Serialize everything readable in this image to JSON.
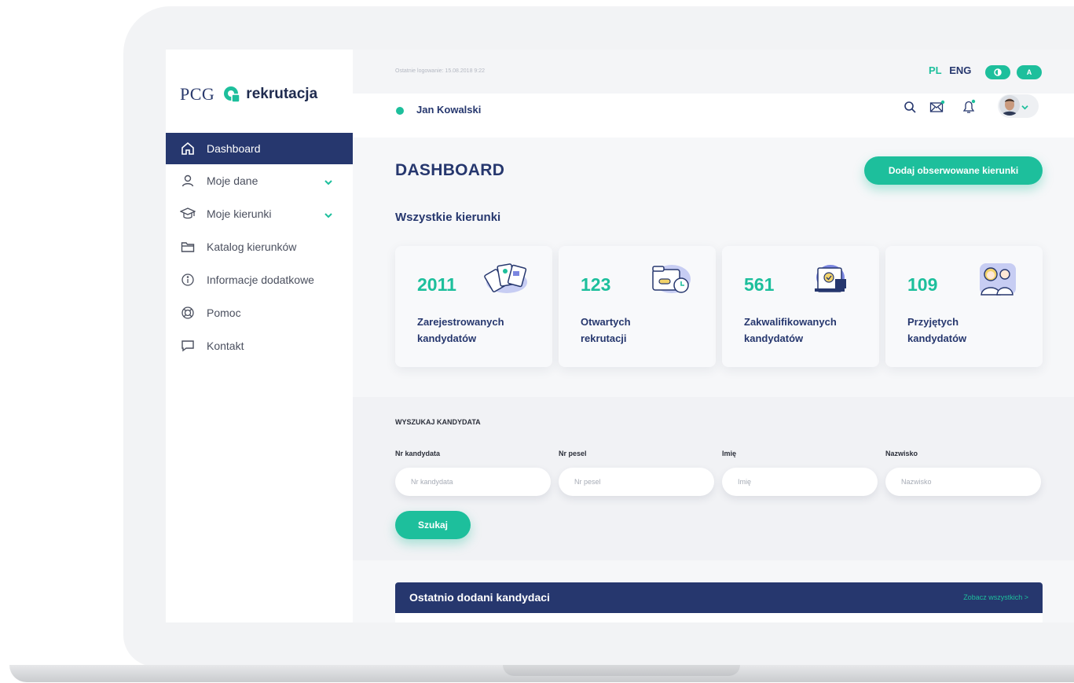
{
  "brand": {
    "pcg": "PCG",
    "word": "rekrutacja"
  },
  "sidebar": {
    "items": [
      {
        "label": "Dashboard",
        "icon": "home-icon",
        "active": true
      },
      {
        "label": "Moje dane",
        "icon": "user-icon",
        "expandable": true
      },
      {
        "label": "Moje kierunki",
        "icon": "graduation-cap-icon",
        "expandable": true
      },
      {
        "label": "Katalog kierunków",
        "icon": "folder-icon"
      },
      {
        "label": "Informacje dodatkowe",
        "icon": "info-icon"
      },
      {
        "label": "Pomoc",
        "icon": "lifebuoy-icon"
      },
      {
        "label": "Kontakt",
        "icon": "chat-icon"
      }
    ]
  },
  "topbar": {
    "last_login": "Ostatnie logowanie: 15.08.2018 9:22",
    "lang_pl": "PL",
    "lang_eng": "ENG",
    "contrast_label": "",
    "font_label": "A"
  },
  "user": {
    "name": "Jan Kowalski",
    "status": "online"
  },
  "page": {
    "title": "DASHBOARD",
    "add_button": "Dodaj obserwowane kierunki",
    "subtitle": "Wszystkie kierunki"
  },
  "stats": [
    {
      "value": "2011",
      "label1": "Zarejestrowanych",
      "label2": "kandydatów"
    },
    {
      "value": "123",
      "label1": "Otwartych",
      "label2": "rekrutacji"
    },
    {
      "value": "561",
      "label1": "Zakwalifikowanych",
      "label2": "kandydatów"
    },
    {
      "value": "109",
      "label1": "Przyjętych",
      "label2": "kandydatów"
    }
  ],
  "search": {
    "title": "WYSZUKAJ KANDYDATA",
    "fields": [
      {
        "label": "Nr kandydata",
        "placeholder": "Nr kandydata"
      },
      {
        "label": "Nr pesel",
        "placeholder": "Nr pesel"
      },
      {
        "label": "Imię",
        "placeholder": "Imię"
      },
      {
        "label": "Nazwisko",
        "placeholder": "Nazwisko"
      }
    ],
    "button": "Szukaj"
  },
  "recent": {
    "title": "Ostatnio dodani kandydaci",
    "link": "Zobacz wszystkich >"
  },
  "colors": {
    "navy": "#26376e",
    "accent": "#1dbf9c",
    "panel": "#f1f2f5"
  }
}
